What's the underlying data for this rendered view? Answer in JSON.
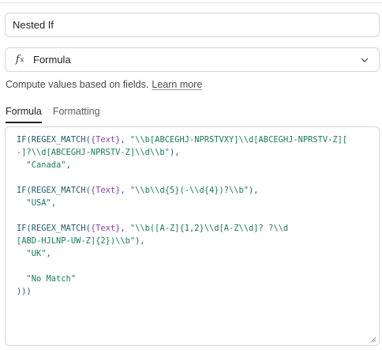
{
  "field_name": {
    "value": "Nested If"
  },
  "field_type": {
    "icon": "fx-icon",
    "label": "Formula"
  },
  "description": {
    "text": "Compute values based on fields.",
    "link": "Learn more"
  },
  "tabs": [
    {
      "label": "Formula",
      "active": true
    },
    {
      "label": "Formatting",
      "active": false
    }
  ],
  "formula_lines": [
    [
      {
        "t": "fn",
        "v": "IF(REGEX_MATCH("
      },
      {
        "t": "ref",
        "v": "{Text}"
      },
      {
        "t": "fn",
        "v": ", "
      },
      {
        "t": "str",
        "v": "\"\\\\b[ABCEGHJ-NPRSTVXY]\\\\d[ABCEGHJ-NPRSTV-Z]["
      }
    ],
    [
      {
        "t": "str",
        "v": "-]?\\\\d[ABCEGHJ-NPRSTV-Z]\\\\d\\\\b\""
      },
      {
        "t": "fn",
        "v": "),"
      }
    ],
    [
      {
        "t": "str",
        "v": "  \"Canada\""
      },
      {
        "t": "fn",
        "v": ","
      }
    ],
    [],
    [
      {
        "t": "fn",
        "v": "IF(REGEX_MATCH("
      },
      {
        "t": "ref",
        "v": "{Text}"
      },
      {
        "t": "fn",
        "v": ", "
      },
      {
        "t": "str",
        "v": "\"\\\\b\\\\d{5}(-\\\\d{4})?\\\\b\""
      },
      {
        "t": "fn",
        "v": "),"
      }
    ],
    [
      {
        "t": "str",
        "v": "  \"USA\""
      },
      {
        "t": "fn",
        "v": ","
      }
    ],
    [],
    [
      {
        "t": "fn",
        "v": "IF(REGEX_MATCH("
      },
      {
        "t": "ref",
        "v": "{Text}"
      },
      {
        "t": "fn",
        "v": ", "
      },
      {
        "t": "str",
        "v": "\"\\\\b([A-Z]{1,2}\\\\d[A-Z\\\\d]? ?\\\\d"
      }
    ],
    [
      {
        "t": "str",
        "v": "[ABD-HJLNP-UW-Z]{2})\\\\b\""
      },
      {
        "t": "fn",
        "v": "),"
      }
    ],
    [
      {
        "t": "str",
        "v": "  \"UK\""
      },
      {
        "t": "fn",
        "v": ","
      }
    ],
    [],
    [
      {
        "t": "str",
        "v": "  \"No Match\""
      }
    ],
    [
      {
        "t": "fn",
        "v": ")))"
      }
    ]
  ]
}
